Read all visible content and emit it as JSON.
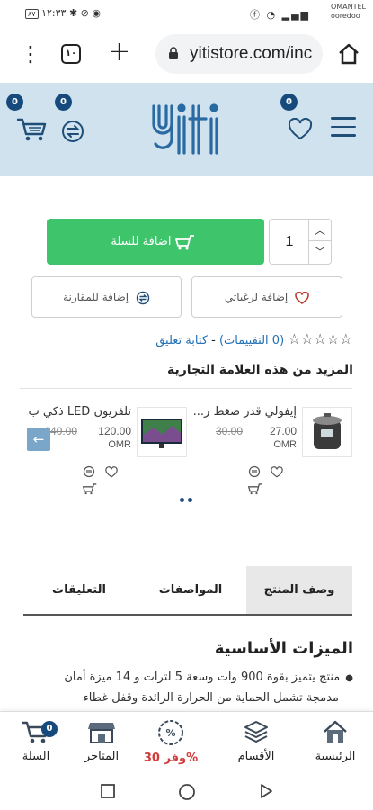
{
  "status_bar": {
    "time": "١٢:٣٣",
    "carrier_line1": "OMANTEL",
    "carrier_line2": "ooredoo",
    "battery": "٨٧"
  },
  "browser": {
    "url": "yitistore.com/inc",
    "tab_count": "١٠"
  },
  "header": {
    "logo_text": "yiti",
    "cart_badge": "0",
    "compare_badge": "0",
    "wishlist_badge": "0"
  },
  "product_actions": {
    "quantity": "1",
    "add_to_cart": "اضافة للسلة",
    "add_to_wishlist": "إضافة لرغباتي",
    "add_to_compare": "إضافة للمقارنة"
  },
  "rating": {
    "reviews": "(0 التقييمات)",
    "separator": "-",
    "write_review": "كتابة تعليق"
  },
  "brand_section": {
    "title": "المزيد من هذه العلامة التجارية",
    "products": [
      {
        "name": "إيفولي قدر ضغط ر...",
        "price": "27.00",
        "old_price": "30.00",
        "currency": "OMR"
      },
      {
        "name": "تلفزيون LED ذكي ب...",
        "price": "120.00",
        "old_price": "140.00",
        "currency": "OMR"
      }
    ]
  },
  "tabs": {
    "description": "وصف المنتج",
    "specs": "المواصفات",
    "comments": "التعليقات"
  },
  "content": {
    "heading": "الميزات الأساسية",
    "line1": "منتج يتميز بقوة 900 وات وسعة 5 لترات و 14 ميزة أمان",
    "line2": "مدمجة تشمل الحماية من الحرارة الزائدة وقفل غطاء"
  },
  "bottom_nav": {
    "home": "الرئيسية",
    "categories": "الأقسام",
    "offers": "وفر 30%",
    "stores": "المتاجر",
    "cart": "السلة",
    "cart_badge": "0"
  },
  "colors": {
    "accent": "#174a7c",
    "header_bg": "#cfe2ee",
    "add_cart": "#3ec46a",
    "link": "#1f6fb5",
    "offer": "#d23b3b"
  }
}
